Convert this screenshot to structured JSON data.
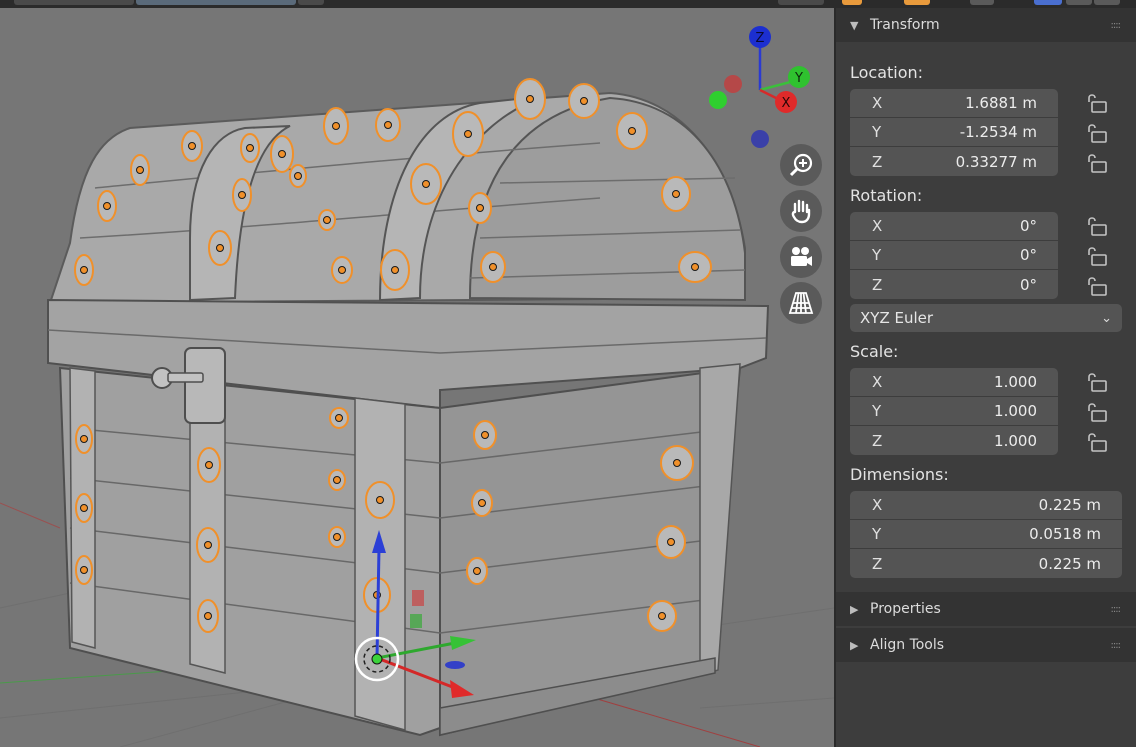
{
  "panel": {
    "transform": {
      "title": "Transform",
      "location_label": "Location:",
      "location": [
        {
          "axis": "X",
          "value": "1.6881 m"
        },
        {
          "axis": "Y",
          "value": "-1.2534 m"
        },
        {
          "axis": "Z",
          "value": "0.33277 m"
        }
      ],
      "rotation_label": "Rotation:",
      "rotation": [
        {
          "axis": "X",
          "value": "0°"
        },
        {
          "axis": "Y",
          "value": "0°"
        },
        {
          "axis": "Z",
          "value": "0°"
        }
      ],
      "rotation_mode": "XYZ Euler",
      "scale_label": "Scale:",
      "scale": [
        {
          "axis": "X",
          "value": "1.000"
        },
        {
          "axis": "Y",
          "value": "1.000"
        },
        {
          "axis": "Z",
          "value": "1.000"
        }
      ],
      "dimensions_label": "Dimensions:",
      "dimensions": [
        {
          "axis": "X",
          "value": "0.225 m"
        },
        {
          "axis": "Y",
          "value": "0.0518 m"
        },
        {
          "axis": "Z",
          "value": "0.225 m"
        }
      ]
    },
    "properties_title": "Properties",
    "align_tools_title": "Align Tools"
  },
  "viewport": {
    "gizmo": {
      "z": "Z",
      "y": "Y",
      "x": "X"
    },
    "nav_buttons": [
      "zoom-icon",
      "hand-pan-icon",
      "camera-icon",
      "perspective-grid-icon"
    ]
  },
  "colors": {
    "x_axis": "#e03030",
    "y_axis": "#3aa63a",
    "z_axis": "#1c2fd0",
    "selection": "#f0902a",
    "panel_bg": "#3d3d3d",
    "field_bg": "#545454",
    "viewport_bg": "#767676"
  }
}
